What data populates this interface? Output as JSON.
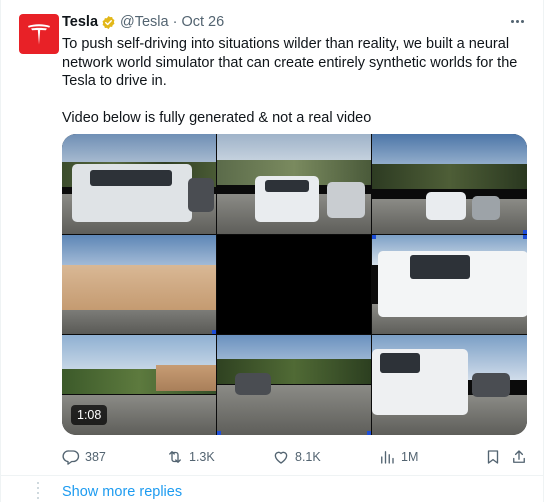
{
  "tweet": {
    "author_name": "Tesla",
    "author_handle": "@Tesla",
    "separator": "·",
    "date": "Oct 26",
    "text_paragraphs": [
      "To push self-driving into situations wilder than reality, we built a neural network world simulator that can create entirely synthetic worlds for the Tesla to drive in.",
      "Video below is fully generated & not a real video"
    ],
    "video_duration": "1:08"
  },
  "metrics": {
    "replies": "387",
    "reposts": "1.3K",
    "likes": "8.1K",
    "views": "1M"
  },
  "footer": {
    "show_more_replies": "Show more replies"
  },
  "icons": {
    "avatar": "tesla-logo",
    "verified": "gold-verified-badge",
    "more": "more-dots-icon",
    "reply": "reply-icon",
    "repost": "repost-icon",
    "like": "heart-icon",
    "views": "views-chart-icon",
    "bookmark": "bookmark-icon",
    "share": "share-icon"
  },
  "colors": {
    "brand_red": "#e82127",
    "verified_gold": "#e2b719",
    "link_blue": "#1d9bf0",
    "muted_text": "#536471"
  }
}
